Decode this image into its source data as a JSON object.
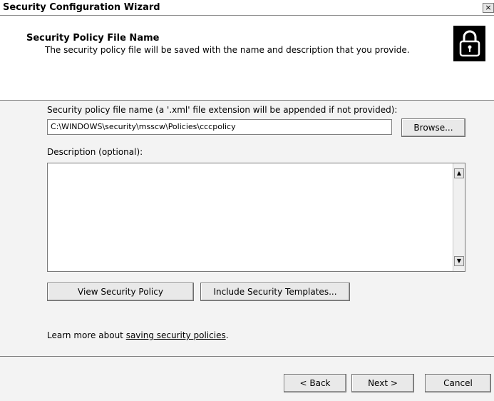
{
  "window": {
    "title": "Security Configuration Wizard",
    "close_glyph": "×"
  },
  "header": {
    "title": "Security Policy File Name",
    "subtitle": "The security policy file will be saved with the name and description that you provide."
  },
  "form": {
    "filename_label": "Security policy file name (a '.xml' file extension will be appended if not provided):",
    "filename_value": "C:\\WINDOWS\\security\\msscw\\Policies\\cccpolicy",
    "browse_label": "Browse...",
    "description_label": "Description (optional):",
    "description_value": ""
  },
  "actions": {
    "view_policy_label": "View Security Policy",
    "include_templates_label": "Include Security Templates..."
  },
  "learn_more": {
    "prefix": "Learn more about ",
    "link_text": "saving security policies",
    "suffix": "."
  },
  "footer": {
    "back_label": "< Back",
    "next_label": "Next >",
    "cancel_label": "Cancel"
  },
  "icons": {
    "header_icon": "lock-icon"
  }
}
